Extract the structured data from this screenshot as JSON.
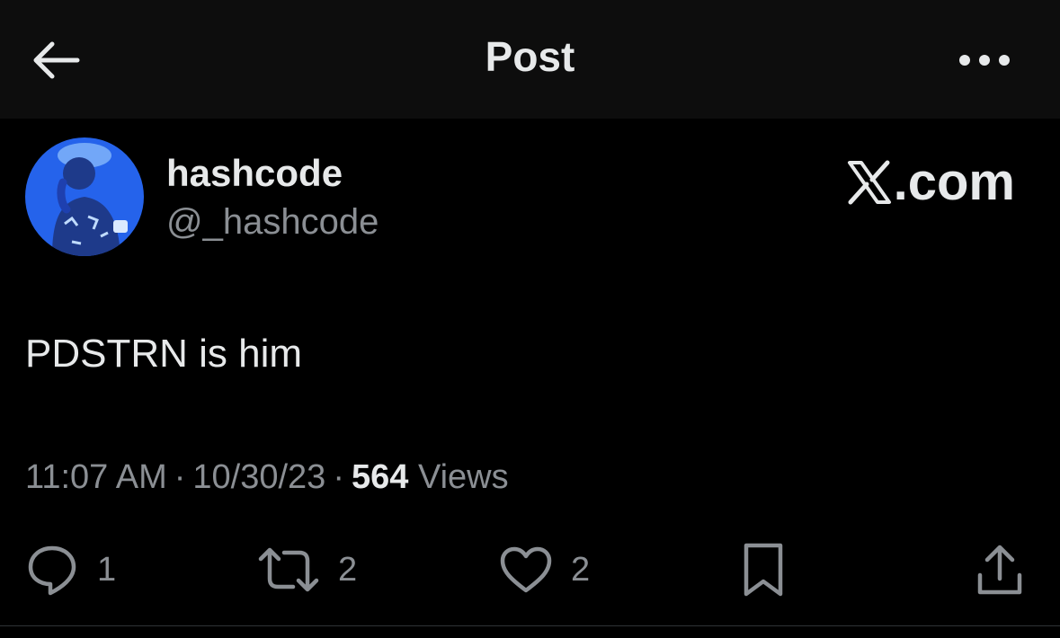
{
  "header": {
    "title": "Post",
    "back_icon": "arrow-left-icon",
    "more_icon": "more-horizontal-icon"
  },
  "author": {
    "display_name": "hashcode",
    "handle": "@_hashcode",
    "avatar_color": "#1d4ed8"
  },
  "brand": {
    "logo_icon": "x-logo-icon",
    "text": ".com"
  },
  "post": {
    "text": "PDSTRN is him"
  },
  "meta": {
    "time": "11:07 AM",
    "separator": "·",
    "date": "10/30/23",
    "views_count": "564",
    "views_label": "Views"
  },
  "actions": {
    "reply": {
      "icon": "reply-icon",
      "count": "1"
    },
    "repost": {
      "icon": "repost-icon",
      "count": "2"
    },
    "like": {
      "icon": "heart-icon",
      "count": "2"
    },
    "bookmark": {
      "icon": "bookmark-icon"
    },
    "share": {
      "icon": "share-icon"
    }
  },
  "colors": {
    "background": "#000000",
    "header_background": "#0d0d0d",
    "primary_text": "#e7e9ea",
    "secondary_text": "#8b8f94"
  }
}
